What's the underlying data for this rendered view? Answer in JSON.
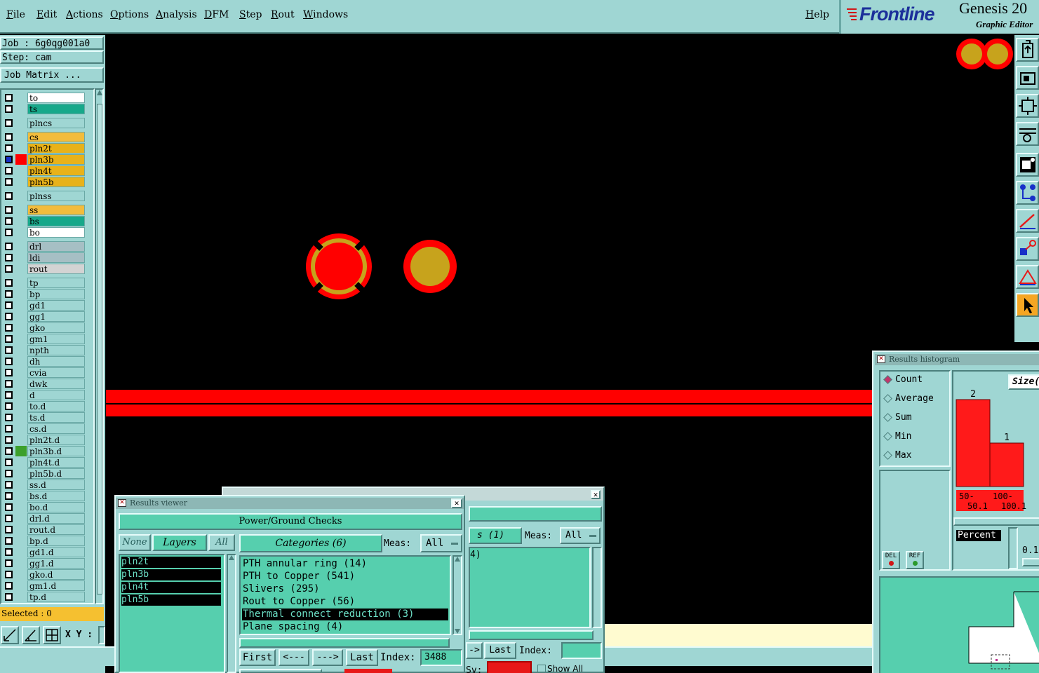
{
  "menu": [
    "File",
    "Edit",
    "Actions",
    "Options",
    "Analysis",
    "DFM",
    "Step",
    "Rout",
    "Windows"
  ],
  "help": "Help",
  "brand": {
    "logo": "Frontline",
    "product": "Genesis 20",
    "subtitle": "Graphic Editor"
  },
  "job": {
    "job_line": "Job : 6g0qg001a0",
    "step_line": "Step: cam",
    "matrix_button": "Job Matrix ..."
  },
  "layers": [
    {
      "name": "to",
      "color": "#ffffff",
      "mark": ""
    },
    {
      "name": "ts",
      "color": "#17a88a",
      "mark": ""
    },
    {
      "name": "plncs",
      "color": "#9fd6d3",
      "mark": ""
    },
    {
      "name": "cs",
      "color": "#f2bc3c",
      "mark": ""
    },
    {
      "name": "pln2t",
      "color": "#e8b21a",
      "mark": ""
    },
    {
      "name": "pln3b",
      "color": "#e8b21a",
      "mark": "#ff0000"
    },
    {
      "name": "pln4t",
      "color": "#e8b21a",
      "mark": ""
    },
    {
      "name": "pln5b",
      "color": "#e8b21a",
      "mark": ""
    },
    {
      "name": "plnss",
      "color": "#9fd6d3",
      "mark": ""
    },
    {
      "name": "ss",
      "color": "#f2bc3c",
      "mark": ""
    },
    {
      "name": "bs",
      "color": "#17a88a",
      "mark": ""
    },
    {
      "name": "bo",
      "color": "#ffffff",
      "mark": ""
    },
    {
      "name": "drl",
      "color": "#a6bfc4",
      "mark": ""
    },
    {
      "name": "ldi",
      "color": "#a6bfc4",
      "mark": ""
    },
    {
      "name": "rout",
      "color": "#d3d3d3",
      "mark": ""
    },
    {
      "name": "tp",
      "color": "#9fd6d3",
      "mark": ""
    },
    {
      "name": "bp",
      "color": "#9fd6d3",
      "mark": ""
    },
    {
      "name": "gd1",
      "color": "#9fd6d3",
      "mark": ""
    },
    {
      "name": "gg1",
      "color": "#9fd6d3",
      "mark": ""
    },
    {
      "name": "gko",
      "color": "#9fd6d3",
      "mark": ""
    },
    {
      "name": "gm1",
      "color": "#9fd6d3",
      "mark": ""
    },
    {
      "name": "npth",
      "color": "#9fd6d3",
      "mark": ""
    },
    {
      "name": "dh",
      "color": "#9fd6d3",
      "mark": ""
    },
    {
      "name": "cvia",
      "color": "#9fd6d3",
      "mark": ""
    },
    {
      "name": "dwk",
      "color": "#9fd6d3",
      "mark": ""
    },
    {
      "name": "d",
      "color": "#9fd6d3",
      "mark": ""
    },
    {
      "name": "to.d",
      "color": "#9fd6d3",
      "mark": ""
    },
    {
      "name": "ts.d",
      "color": "#9fd6d3",
      "mark": ""
    },
    {
      "name": "cs.d",
      "color": "#9fd6d3",
      "mark": ""
    },
    {
      "name": "pln2t.d",
      "color": "#9fd6d3",
      "mark": ""
    },
    {
      "name": "pln3b.d",
      "color": "#9fd6d3",
      "mark": "#3ca02c"
    },
    {
      "name": "pln4t.d",
      "color": "#9fd6d3",
      "mark": ""
    },
    {
      "name": "pln5b.d",
      "color": "#9fd6d3",
      "mark": ""
    },
    {
      "name": "ss.d",
      "color": "#9fd6d3",
      "mark": ""
    },
    {
      "name": "bs.d",
      "color": "#9fd6d3",
      "mark": ""
    },
    {
      "name": "bo.d",
      "color": "#9fd6d3",
      "mark": ""
    },
    {
      "name": "drl.d",
      "color": "#9fd6d3",
      "mark": ""
    },
    {
      "name": "rout.d",
      "color": "#9fd6d3",
      "mark": ""
    },
    {
      "name": "bp.d",
      "color": "#9fd6d3",
      "mark": ""
    },
    {
      "name": "gd1.d",
      "color": "#9fd6d3",
      "mark": ""
    },
    {
      "name": "gg1.d",
      "color": "#9fd6d3",
      "mark": ""
    },
    {
      "name": "gko.d",
      "color": "#9fd6d3",
      "mark": ""
    },
    {
      "name": "gm1.d",
      "color": "#9fd6d3",
      "mark": ""
    },
    {
      "name": "tp.d",
      "color": "#9fd6d3",
      "mark": ""
    }
  ],
  "status": {
    "selected": "Selected : 0",
    "xy_label": "X Y :"
  },
  "results_viewer": {
    "title": "Results viewer",
    "header": "Power/Ground Checks",
    "none_btn": "None",
    "layers_label": "Layers",
    "all_btn": "All",
    "layers": [
      "pln2t",
      "pln3b",
      "pln4t",
      "pln5b"
    ],
    "categories_label": "Categories (6)",
    "meas_label": "Meas:",
    "meas_value": "All",
    "categories": [
      "PTH annular ring (14)",
      "PTH to Copper (541)",
      "Slivers (295)",
      "Rout to Copper (56)",
      "Thermal connect reduction (3)",
      "Plane spacing (4)"
    ],
    "selected_category": 4,
    "first_btn": "First",
    "prev_btn": "<---",
    "next_btn": "--->",
    "last_btn": "Last",
    "index_label": "Index:",
    "index_value": "3488"
  },
  "back_window": {
    "title_frag": "s (1)",
    "meas_label": "Meas:",
    "meas_value": "All",
    "list_item": "4)",
    "next_btn": "->",
    "last_btn": "Last",
    "index_label": "Index:",
    "sv_label": "Sv:",
    "show_all": "Show All"
  },
  "histogram": {
    "title": "Results histogram",
    "modes": [
      "Count",
      "Average",
      "Sum",
      "Min",
      "Max"
    ],
    "selected_mode": 0,
    "size_label": "Size(",
    "percent_label": "Percent",
    "percent_value": "0.1",
    "del_btn": "DEL",
    "ref_btn": "REF"
  },
  "chart_data": {
    "type": "bar",
    "categories": [
      "50-\n50.1",
      "100-\n100.1"
    ],
    "values": [
      2,
      1
    ],
    "ylim": [
      0,
      2.4
    ]
  },
  "tools": [
    "open-icon",
    "zoom-home-icon",
    "fit-icon",
    "snap-icon",
    "measure-icon",
    "net-icon",
    "line-icon",
    "select-shape-icon",
    "triangle-icon",
    "pointer-icon"
  ]
}
